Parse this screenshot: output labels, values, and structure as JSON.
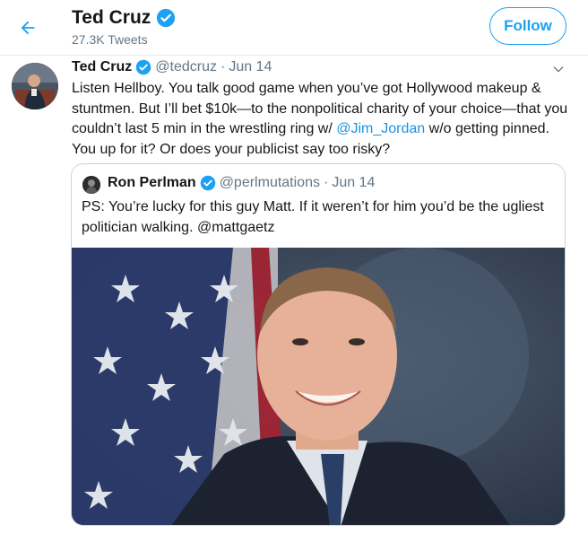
{
  "header": {
    "title": "Ted Cruz",
    "tweet_count": "27.3K Tweets",
    "follow_label": "Follow"
  },
  "tweet": {
    "name": "Ted Cruz",
    "handle": "@tedcruz",
    "separator": "·",
    "date": "Jun 14",
    "text_part1": "Listen Hellboy. You talk good game when you’ve got Hollywood makeup & stuntmen. But I’ll bet $10k—to the nonpolitical charity of your choice—that you couldn’t last 5 min in the wrestling ring w/ ",
    "mention": "@Jim_Jordan",
    "text_part2": " w/o getting pinned. You up for it?  Or does your publicist say too risky?"
  },
  "quote": {
    "name": "Ron Perlman",
    "handle": "@perlmutations",
    "separator": "·",
    "date": "Jun 14",
    "text": "PS: You’re lucky for this guy Matt. If it weren’t for him you’d be the ugliest politician walking.  @mattgaetz"
  },
  "colors": {
    "accent": "#1da1f2",
    "mention": "#1b95e0",
    "muted": "#657786",
    "border": "#ccd6dd"
  },
  "icons": [
    "back-arrow-icon",
    "verified-badge-icon",
    "chevron-down-icon"
  ]
}
